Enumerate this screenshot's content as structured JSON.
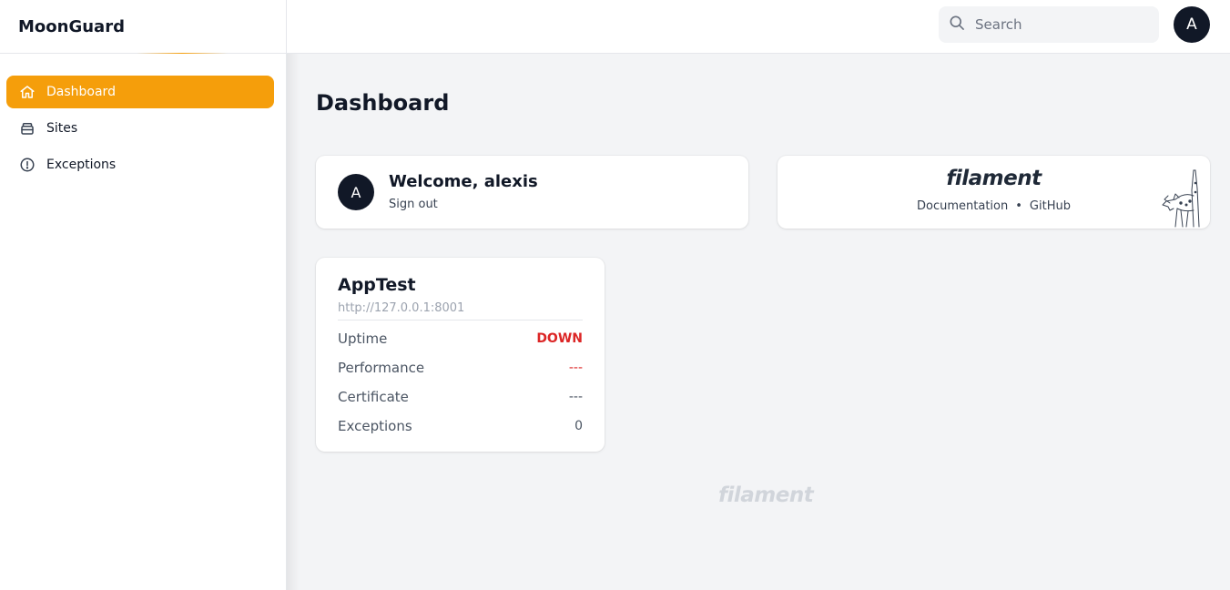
{
  "app": {
    "brand": "MoonGuard"
  },
  "sidebar": {
    "items": [
      {
        "label": "Dashboard",
        "icon": "home-icon"
      },
      {
        "label": "Sites",
        "icon": "database-icon"
      },
      {
        "label": "Exceptions",
        "icon": "exclamation-circle-icon"
      }
    ],
    "active": "Dashboard"
  },
  "topbar": {
    "search_placeholder": "Search",
    "avatar_initial": "A"
  },
  "page": {
    "title": "Dashboard"
  },
  "welcome": {
    "avatar_initial": "A",
    "title": "Welcome, alexis",
    "signout": "Sign out"
  },
  "filament": {
    "logo": "filament",
    "doc_link": "Documentation",
    "separator": "•",
    "github_link": "GitHub"
  },
  "site": {
    "name": "AppTest",
    "url": "http://127.0.0.1:8001",
    "metrics": [
      {
        "label": "Uptime",
        "value": "DOWN"
      },
      {
        "label": "Performance",
        "value": "---"
      },
      {
        "label": "Certificate",
        "value": "---"
      },
      {
        "label": "Exceptions",
        "value": "0"
      }
    ]
  },
  "footer": {
    "logo": "filament"
  },
  "colors": {
    "accent": "#f59e0b",
    "danger": "#dc2626",
    "dark": "#111827"
  }
}
